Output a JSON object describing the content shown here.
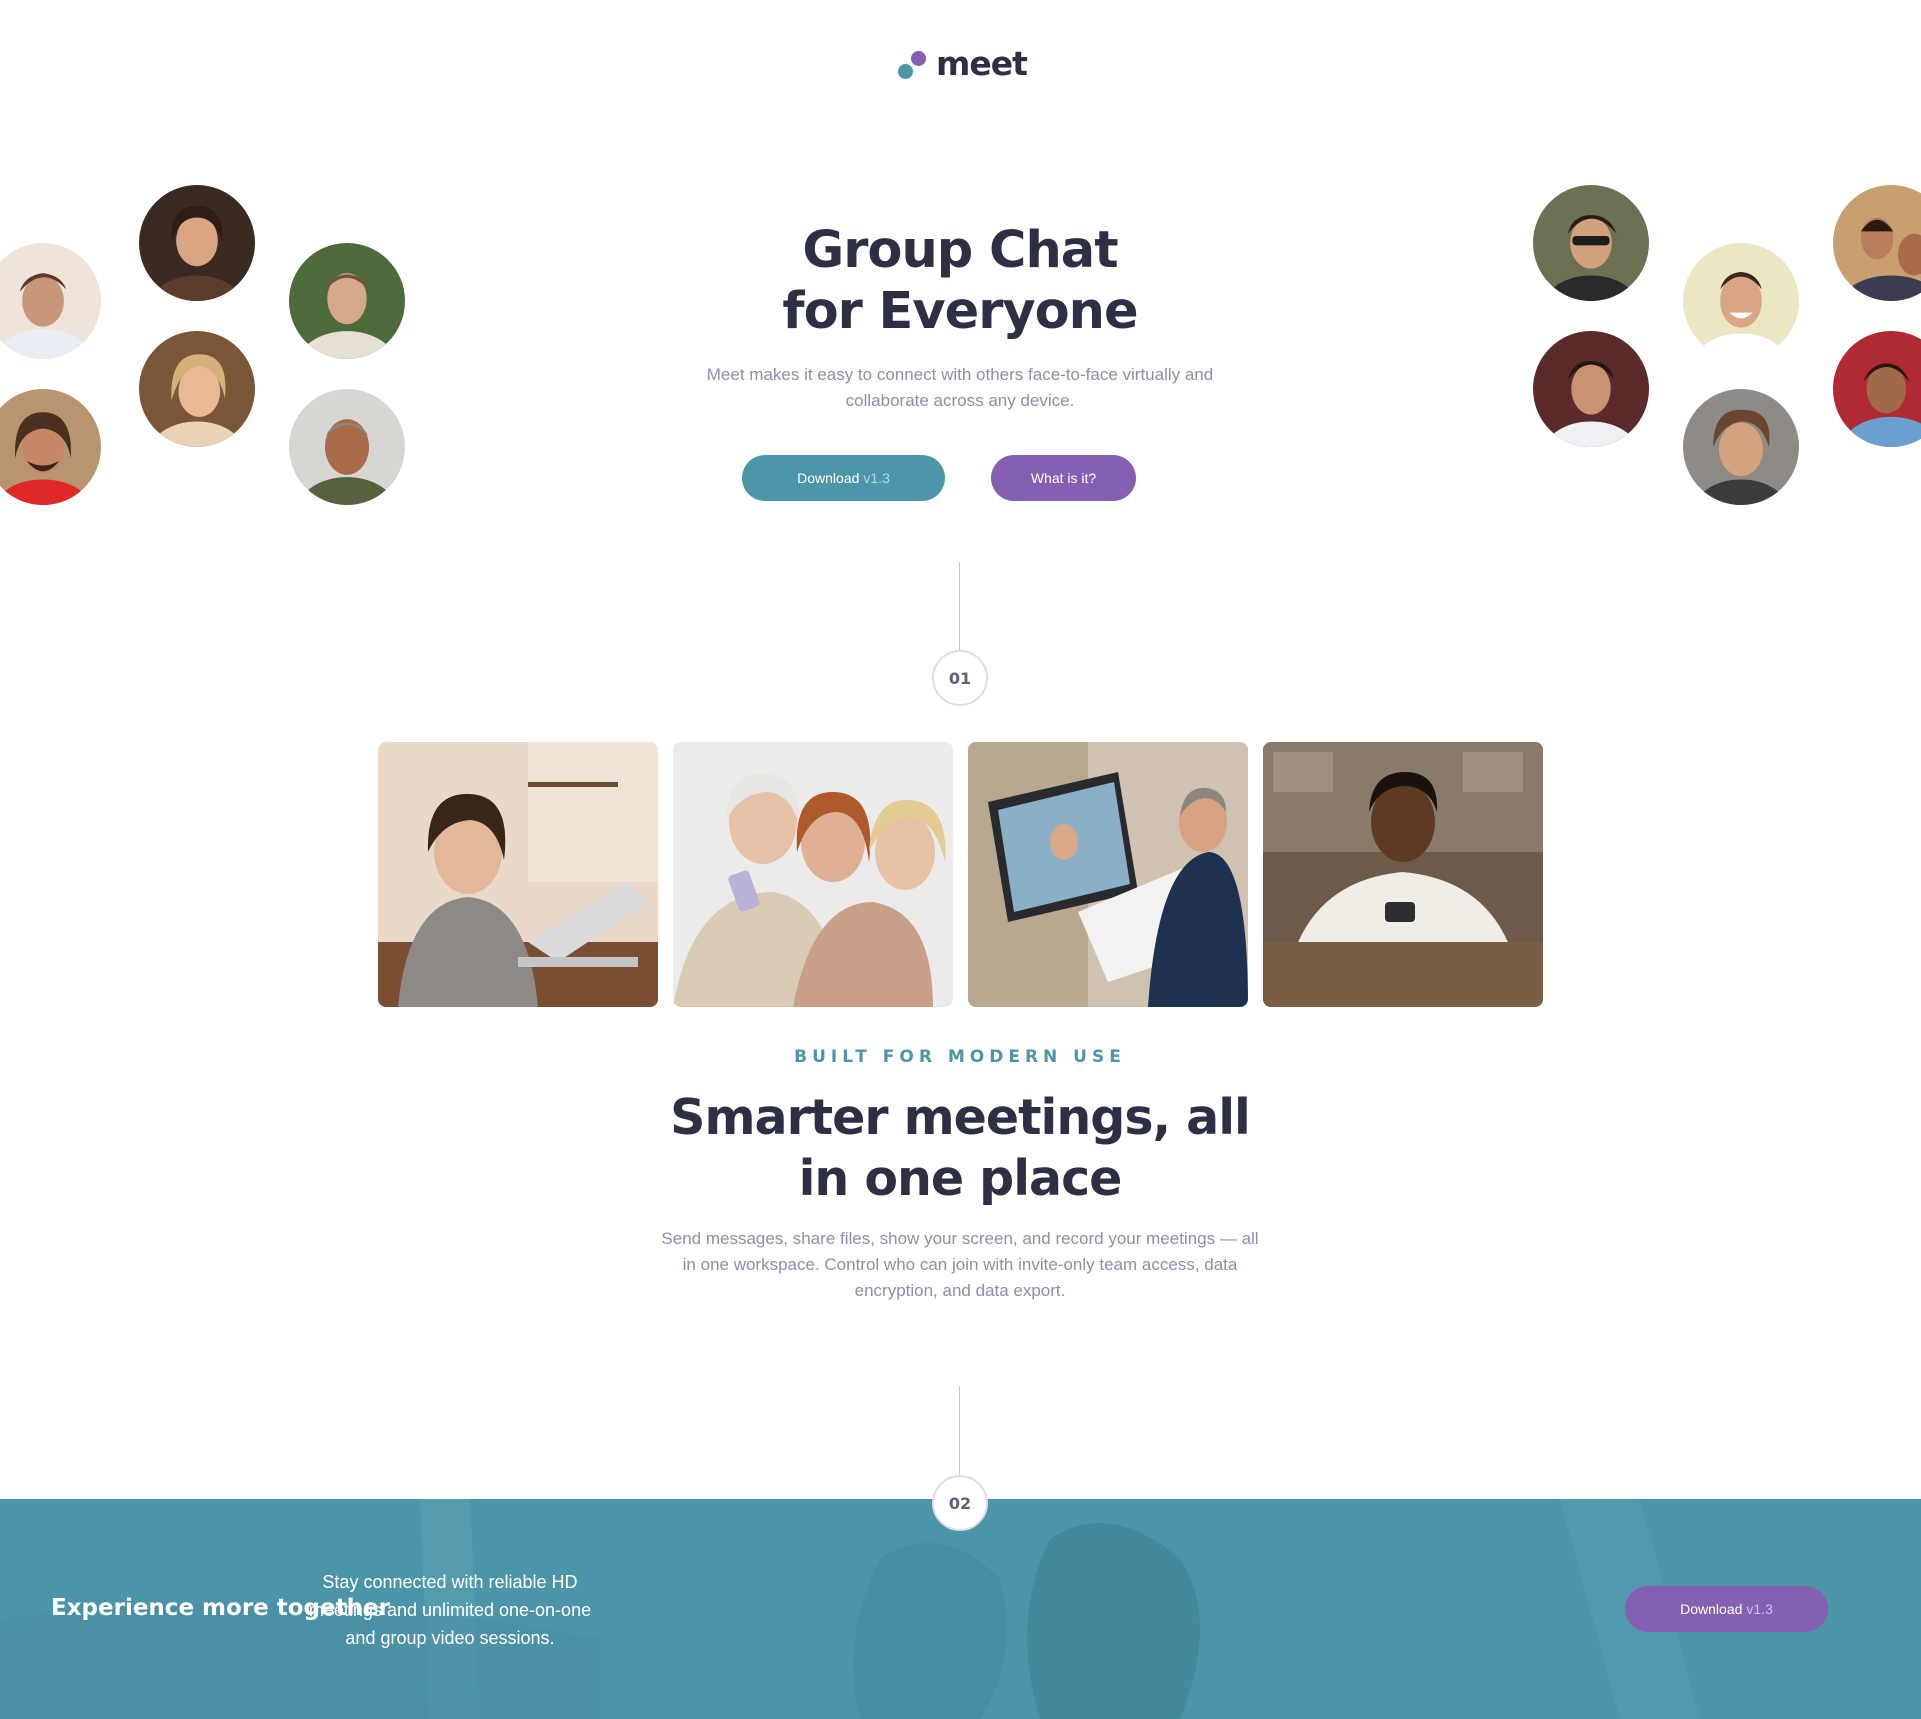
{
  "brand": {
    "name": "meet"
  },
  "hero": {
    "title_line1": "Group Chat",
    "title_line2": "for Everyone",
    "subtitle": "Meet makes it easy to connect with others face-to-face virtually and collaborate across any device.",
    "primary_button": {
      "label": "Download",
      "version": "v1.3"
    },
    "secondary_button": {
      "label": "What is it?"
    }
  },
  "steps": [
    "01",
    "02"
  ],
  "features": {
    "eyebrow": "BUILT FOR MODERN USE",
    "title_line1": "Smarter meetings, all",
    "title_line2": "in one place",
    "body": "Send messages, share files, show your screen, and record your meetings — all in one workspace. Control who can join with invite-only team access, data encryption, and data export."
  },
  "cta": {
    "title": "Experience more together",
    "body": "Stay connected with reliable HD meetings and unlimited one-on-one and group video sessions.",
    "button": {
      "label": "Download",
      "version": "v1.3"
    }
  },
  "colors": {
    "accent_teal": "#4d96a9",
    "accent_purple": "#855fb1",
    "heading": "#2e2f45",
    "body_text": "#8e8ea8",
    "band_background": "#4c95a8"
  }
}
